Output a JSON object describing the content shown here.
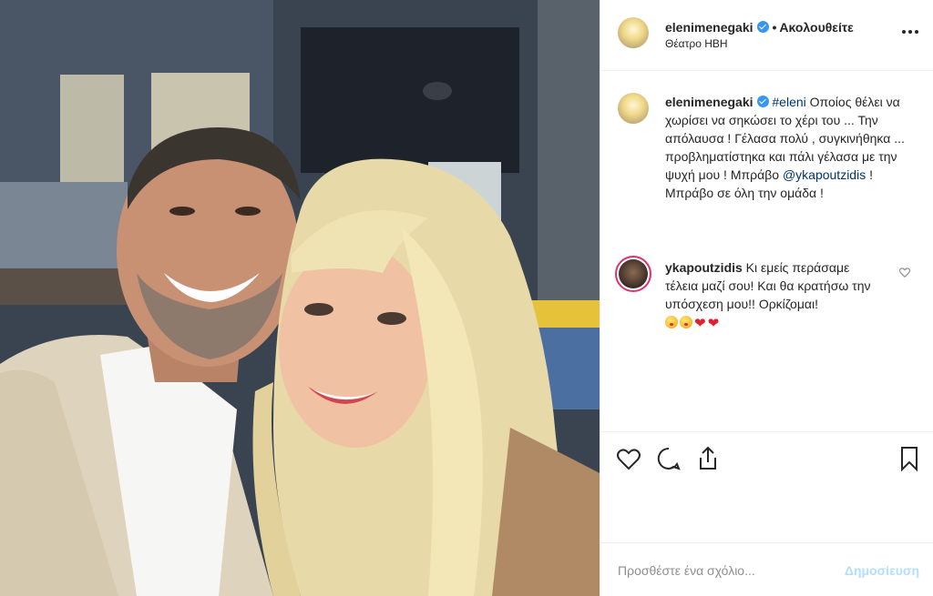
{
  "header": {
    "username": "elenimenegaki",
    "separator": "•",
    "follow_status": "Ακολουθείτε",
    "location": "Θέατρο ΗΒΗ",
    "more_label": "•••"
  },
  "caption": {
    "username": "elenimenegaki",
    "hashtag": "#eleni",
    "text_part1": " Οποίος θέλει να χωρίσει να σηκώσει το χέρι του ... Την απόλαυσα ! Γέλασα πολύ , συγκινήθηκα ... προβληματίστηκα και πάλι γέλασα με την ψυχή μου ! Μπράβο ",
    "mention": "@ykapoutzidis",
    "text_part2": " ! Μπράβο σε όλη την ομάδα !"
  },
  "comment": {
    "username": "ykapoutzidis",
    "text": " Κι εμείς περάσαμε τέλεια μαζί σου! Και θα κρατήσω την υπόσχεση μου!! Ορκίζομαι!",
    "emoji": [
      "face-blowing-kiss",
      "face-blowing-kiss",
      "red-heart",
      "red-heart"
    ],
    "heart_glyph": "❤"
  },
  "add_comment": {
    "placeholder": "Προσθέστε ένα σχόλιο...",
    "post_label": "Δημοσίευση"
  },
  "colors": {
    "verified_badge": "#3897f0",
    "mention": "#003569",
    "post_button_disabled": "#b2dffc",
    "story_ring": "#e1306c"
  }
}
